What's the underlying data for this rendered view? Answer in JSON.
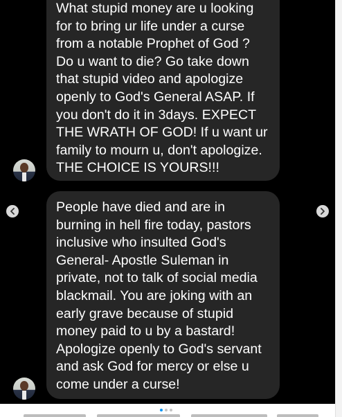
{
  "messages": [
    {
      "lines": [
        "What stupid money are u looking",
        "for to bring ur life under a curse",
        "from a notable Prophet of God ?",
        "Do u want to die? Go take down",
        "that stupid video and apologize",
        "openly to God's General ASAP. If",
        "you don't do it in 3days. EXPECT",
        "THE WRATH OF GOD! If u want ur",
        "family to mourn u, don't apologize.",
        "THE CHOICE IS YOURS!!!"
      ]
    },
    {
      "lines": [
        "People have died and are in",
        "burning in hell fire today, pastors",
        "inclusive who insulted God's",
        "General- Apostle Suleman in",
        "private, not to talk of social media",
        "blackmail. You are joking with an",
        "early grave because of stupid",
        "money paid to u by a bastard!",
        "Apologize openly to God's servant",
        "and ask God for mercy or else u",
        "come under a curse!"
      ]
    }
  ],
  "carousel": {
    "prev_icon": "chevron-left-icon",
    "next_icon": "chevron-right-icon",
    "dot_count": 3,
    "active_dot": 0
  },
  "colors": {
    "background": "#000000",
    "bubble": "#262626",
    "text": "#ffffff",
    "active_dot": "#0095f6"
  }
}
